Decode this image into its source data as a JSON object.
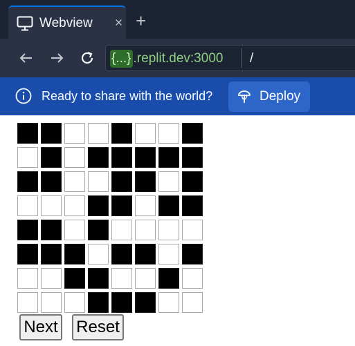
{
  "tab": {
    "title": "Webview",
    "icon": "monitor-icon",
    "close_label": "×",
    "new_tab_label": "+"
  },
  "address_bar": {
    "host_chip": "{...}",
    "host_domain": ".replit.dev:3000",
    "path": "/"
  },
  "banner": {
    "message": "Ready to share with the world?",
    "deploy_label": "Deploy"
  },
  "grid": {
    "rows": [
      [
        1,
        1,
        0,
        0,
        1,
        0,
        0,
        1
      ],
      [
        0,
        1,
        0,
        1,
        1,
        1,
        1,
        1
      ],
      [
        1,
        1,
        0,
        0,
        1,
        1,
        0,
        1
      ],
      [
        0,
        0,
        0,
        1,
        1,
        0,
        1,
        1
      ],
      [
        1,
        1,
        0,
        1,
        0,
        0,
        0,
        0
      ],
      [
        1,
        1,
        1,
        0,
        1,
        1,
        0,
        1
      ],
      [
        0,
        0,
        1,
        1,
        0,
        0,
        1,
        0
      ],
      [
        0,
        0,
        0,
        1,
        1,
        1,
        0,
        0
      ]
    ],
    "on_color": "#000000",
    "off_color": "#ffffff"
  },
  "buttons": {
    "next_label": "Next",
    "reset_label": "Reset"
  },
  "colors": {
    "tabbar": "#1c2333",
    "addressbar": "#2b3245",
    "banner": "#1a4dab",
    "deploy_button": "#2d65c8",
    "accent": "#0079f2"
  }
}
